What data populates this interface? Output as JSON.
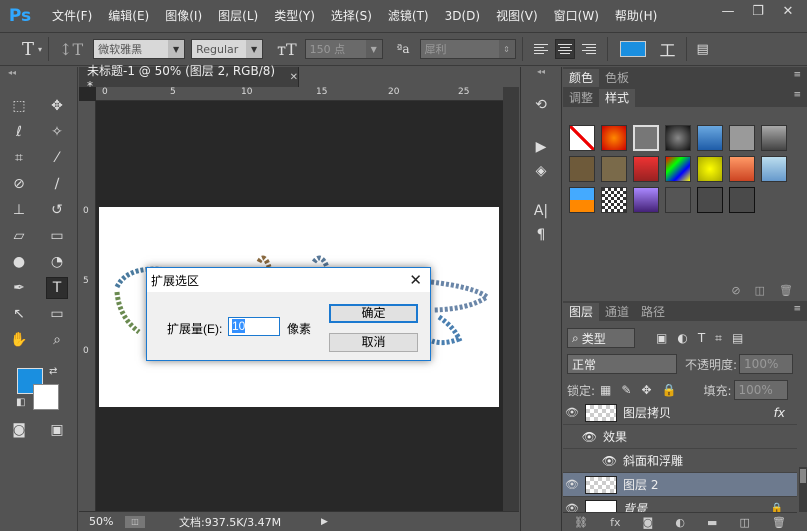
{
  "app": {
    "logo": "Ps"
  },
  "menubar": {
    "items": [
      "文件(F)",
      "编辑(E)",
      "图像(I)",
      "图层(L)",
      "类型(Y)",
      "选择(S)",
      "滤镜(T)",
      "3D(D)",
      "视图(V)",
      "窗口(W)",
      "帮助(H)"
    ],
    "minimize": "—",
    "restore": "❐",
    "close": "✕"
  },
  "options": {
    "font_family": "微软雅黑",
    "font_style": "Regular",
    "font_size": "150 点",
    "aa_label": "ªa",
    "antialias": "犀利",
    "text_color": "#1a8fe0"
  },
  "document": {
    "tab_title": "未标题-1 @ 50% (图层 2, RGB/8) *",
    "close": "✕",
    "ruler_ticks_top": [
      "0",
      "5",
      "10",
      "15",
      "20",
      "25"
    ],
    "ruler_ticks_left": [
      "0",
      "5",
      "0"
    ]
  },
  "status": {
    "zoom": "50%",
    "doc_size": "文档:937.5K/3.47M"
  },
  "dialog": {
    "title": "扩展选区",
    "label": "扩展量(E):",
    "value": "10",
    "unit": "像素",
    "ok": "确定",
    "cancel": "取消"
  },
  "panels": {
    "color_tabs": [
      "颜色",
      "色板"
    ],
    "adjust_tabs": [
      "调整",
      "样式"
    ],
    "layers_tabs": [
      "图层",
      "通道",
      "路径"
    ],
    "filter_kind": "类型",
    "blend_mode": "正常",
    "opacity_label": "不透明度:",
    "opacity_value": "100%",
    "lock_label": "锁定:",
    "fill_label": "填充:",
    "fill_value": "100%",
    "layers": [
      {
        "name": "图层拷贝",
        "fx": "fx"
      },
      {
        "name": "效果"
      },
      {
        "name": "斜面和浮雕"
      },
      {
        "name": "图层 2"
      },
      {
        "name": "背景"
      }
    ]
  },
  "colors": {
    "foreground": "#1a8fe0",
    "background": "#ffffff",
    "selected_layer": "#6d7a8e"
  }
}
